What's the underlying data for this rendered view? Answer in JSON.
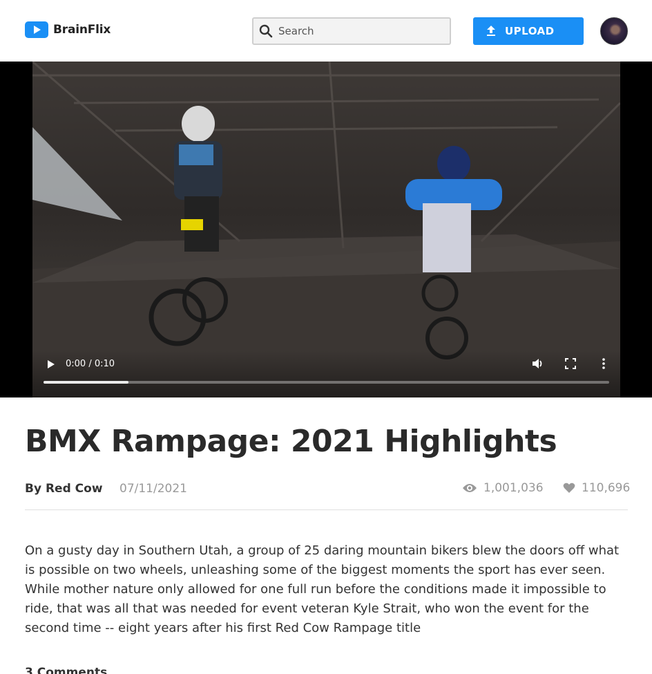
{
  "app": {
    "name": "BrainFlix",
    "brand_color": "#1a8ff5"
  },
  "header": {
    "search": {
      "placeholder": "Search",
      "icon": "search-icon"
    },
    "upload_button": {
      "label": "UPLOAD",
      "icon": "upload-icon"
    },
    "avatar": {
      "icon": "user-avatar"
    }
  },
  "video": {
    "time_display": "0:00 / 0:10",
    "progress": 0.15,
    "controls": [
      "play-icon",
      "volume-icon",
      "fullscreen-icon",
      "more-options-icon"
    ]
  },
  "details": {
    "title": "BMX Rampage: 2021 Highlights",
    "channel": "By Red Cow",
    "date": "07/11/2021",
    "views": "1,001,036",
    "likes": "110,696",
    "description": "On a gusty day in Southern Utah, a group of 25 daring mountain bikers blew the doors off what is possible on two wheels, unleashing some of the biggest moments the sport has ever seen. While mother nature only allowed for one full run before the conditions made it impossible to ride, that was all that was needed for event veteran Kyle Strait, who won the event for the second time -- eight years after his first Red Cow Rampage title"
  },
  "comments": {
    "count_label": "3 Comments"
  }
}
